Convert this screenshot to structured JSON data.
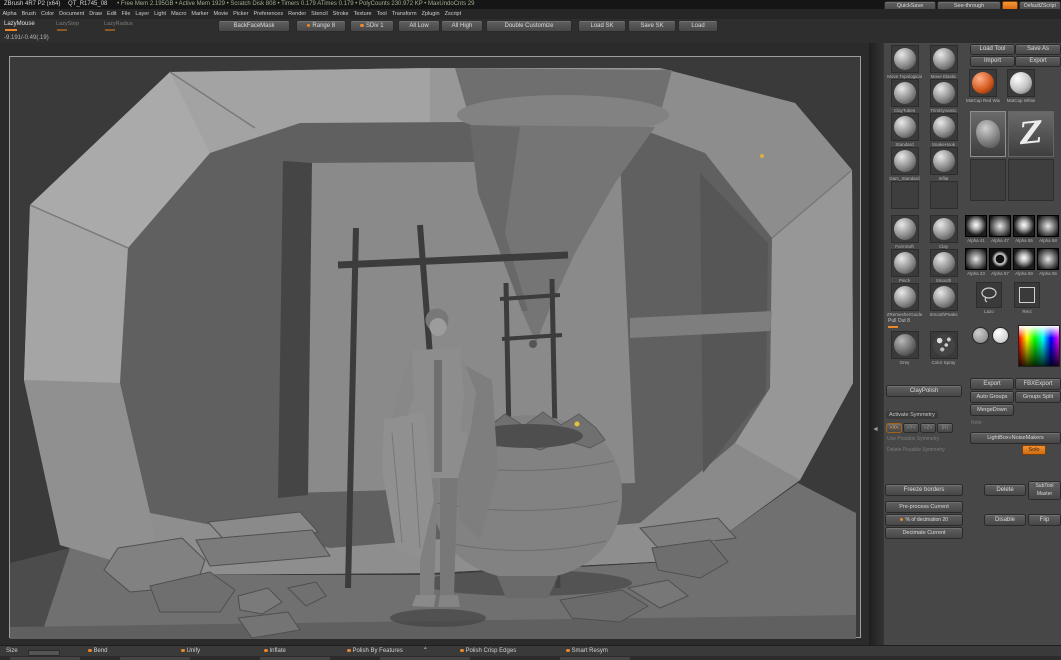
{
  "titlebar": {
    "app_title": "ZBrush 4R7 P2 (x64)",
    "doc_name": "QT_R1745_08",
    "stats": "• Free Mem 2.195GB • Active Mem 1929 • Scratch Disk 808 • Timers 0.179 ATimes 0.179 • PolyCounts 230.972 KP • MaxUndoCnts 29",
    "quicksave": "QuickSave",
    "see_through": "See-through",
    "default_zscript": "DefaultZScript"
  },
  "menubar": {
    "items": [
      "Alpha",
      "Brush",
      "Color",
      "Document",
      "Draw",
      "Edit",
      "File",
      "Layer",
      "Light",
      "Macro",
      "Marker",
      "Movie",
      "Picker",
      "Preferences",
      "Render",
      "Stencil",
      "Stroke",
      "Texture",
      "Tool",
      "Transform",
      "Zplugin",
      "Zscript"
    ]
  },
  "shelf": {
    "lazy_mouse": "LazyMouse",
    "lazy_step": "LazyStep",
    "lazy_radius": "LazyRadius",
    "backface_mask": "BackFaceMask",
    "range": "Range 8",
    "sdiv": "SDiv 1",
    "all_low": "All Low",
    "all_high": "All High",
    "double_customize": "Double Customize",
    "load_sk": "Load SK",
    "save_sk": "Save SK",
    "load": "Load"
  },
  "coords_readout": "-9.191/-0.49(.19)",
  "right_panel": {
    "load_tool": "Load Tool",
    "save_as": "Save As",
    "import": "Import",
    "export_top": "Export",
    "recent_tools": {
      "red_label": "MatCap Red Wax",
      "white_label": "MatCap White"
    },
    "brushes": [
      "Move Topological",
      "Move Elastic",
      "ClayTubes",
      "TrimDynamic",
      "Standard",
      "SnakeHook",
      "Dam_Standard",
      "Inflat",
      "FormSoft",
      "Clay",
      "Pinch",
      "Smooth",
      "ZRemesherGuide",
      "SmoothPeaks"
    ],
    "pull_out": "Pull Out 8",
    "material_thumb": "Grey",
    "stroke_thumb": "Color Spray",
    "claypolish": "ClayPolish",
    "symmetry": {
      "header": "Activate Symmetry",
      "x": ">X<",
      "y": ">Y<",
      "z": ">Z<",
      "r": "(R)",
      "use_posable": "Use Posable Symmetry",
      "delete_posable": "Delete Posable Symmetry"
    },
    "decimation": {
      "freeze": "Freeze borders",
      "preprocess": "Pre-process Current",
      "percent_label": "% of decimation",
      "percent_value": "20",
      "decimate": "Decimate Current"
    },
    "alphas": [
      "Alpha 41",
      "Alpha 47",
      "Alpha 55",
      "Alpha 58",
      "Alpha 23",
      "Alpha 57",
      "Alpha 59",
      "Alpha 06"
    ],
    "strokes": {
      "lazo": "Lazo",
      "rect": "Rect"
    },
    "actions": {
      "export": "Export",
      "fbx_export": "FBXExport",
      "auto_groups": "Auto Groups",
      "groups_split": "Groups Split",
      "merge_down": "MergeDown",
      "note": "Note:",
      "lightbox_noisemakers": "LightBox»NoiseMakers",
      "solo": "Solo",
      "delete": "Delete",
      "subtool_master_line1": "SubTool",
      "subtool_master_line2": "Master",
      "disable": "Disable",
      "flip": "Flip"
    }
  },
  "bottom_bar": {
    "size": "Size",
    "items": [
      "Bend",
      "Unify",
      "Inflate",
      "Polish By Features",
      "Polish Crisp Edges",
      "Smart Resym"
    ]
  },
  "icons": {
    "simple_brush": "Z",
    "tray_collapse": "▴",
    "divider_arrow": "◄"
  },
  "colors": {
    "accent_orange": "#e8872a"
  }
}
